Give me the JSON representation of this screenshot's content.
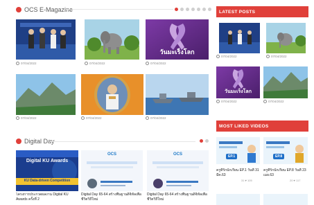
{
  "emagazine": {
    "title": "OCS E-Magazine",
    "dots_total": 7,
    "dot_active": 0,
    "items": [
      {
        "date": "07/04/2022"
      },
      {
        "date": "07/04/2022"
      },
      {
        "date": "07/04/2022",
        "ribbon_text": "วันมะเร็งโลก"
      },
      {
        "date": "07/04/2022"
      },
      {
        "date": "07/04/2022"
      },
      {
        "date": "07/04/2022"
      }
    ]
  },
  "digital_day": {
    "title": "Digital Day",
    "dots_total": 2,
    "dot_active": 0,
    "items": [
      {
        "banner_line1": "Digital KU Awards",
        "banner_line2": "KU Data-driven Competition",
        "caption": "โครงการประกวดผลงาน Digital KU Awards ครั้งที่ 2"
      },
      {
        "banner_line1": "OCS",
        "caption": "Digital Day 65-64 สร้างพื้นฐานดิจิทัลเพื่อชีวิตวิถีใหม่"
      },
      {
        "banner_line1": "OCS",
        "caption": "Digital Day 65-64 สร้างพื้นฐานดิจิทัลเพื่อชีวิตวิถีใหม่"
      }
    ]
  },
  "latest_posts": {
    "title": "LATEST POSTS",
    "items": [
      {
        "date": "07/04/2022"
      },
      {
        "date": "07/04/2022"
      },
      {
        "date": "07/04/2022",
        "ribbon_text": "วันมะเร็งโลก"
      },
      {
        "date": "07/04/2022"
      }
    ]
  },
  "most_liked": {
    "title": "MOST LIKED VIDEOS",
    "items": [
      {
        "ep": "EP.1",
        "caption": "ครูที่รักนักเรียน EP.1 วันที่ 31 มีค.63",
        "meta": "31 ♥ 105"
      },
      {
        "ep": "EP.8",
        "caption": "ครูที่รักนักเรียน EP.8 วันที่ 23 เมย.63",
        "meta": "20 ♥ 117"
      }
    ]
  }
}
